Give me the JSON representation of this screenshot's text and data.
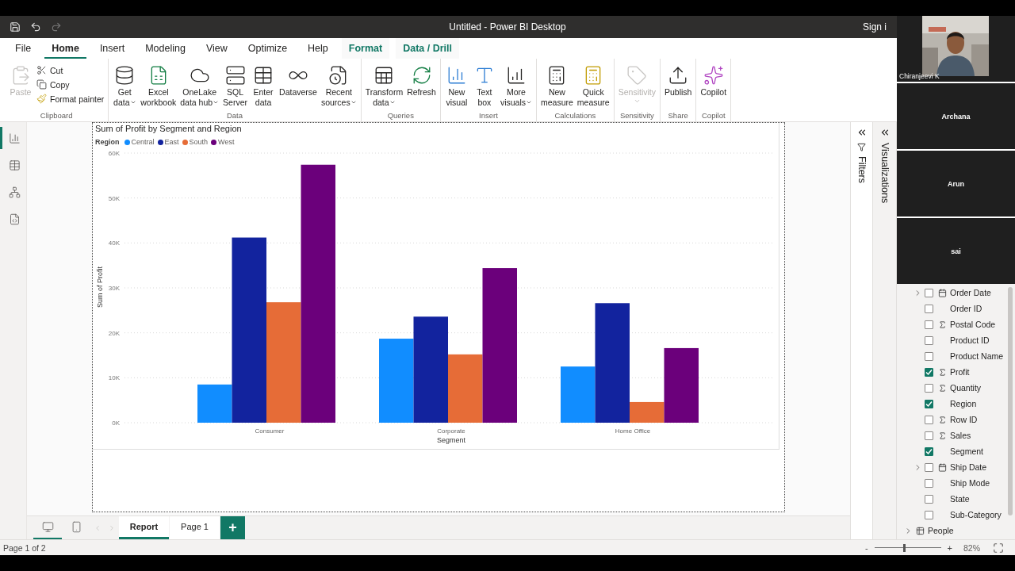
{
  "window": {
    "title": "Untitled - Power BI Desktop",
    "sign_in": "Sign i"
  },
  "menu_tabs": [
    {
      "label": "File",
      "selected": false,
      "kind": "standard"
    },
    {
      "label": "Home",
      "selected": true,
      "kind": "standard"
    },
    {
      "label": "Insert",
      "selected": false,
      "kind": "standard"
    },
    {
      "label": "Modeling",
      "selected": false,
      "kind": "standard"
    },
    {
      "label": "View",
      "selected": false,
      "kind": "standard"
    },
    {
      "label": "Optimize",
      "selected": false,
      "kind": "standard"
    },
    {
      "label": "Help",
      "selected": false,
      "kind": "standard"
    },
    {
      "label": "Format",
      "selected": false,
      "kind": "contextual"
    },
    {
      "label": "Data / Drill",
      "selected": false,
      "kind": "contextual"
    }
  ],
  "ribbon": [
    {
      "label": "Clipboard",
      "large": [
        {
          "lines": [
            "Paste"
          ],
          "disabled": true,
          "dropdown": false
        }
      ],
      "small": [
        {
          "label": "Cut"
        },
        {
          "label": "Copy"
        },
        {
          "label": "Format painter"
        }
      ]
    },
    {
      "label": "Data",
      "large": [
        {
          "lines": [
            "Get",
            "data"
          ],
          "disabled": false,
          "dropdown": true
        },
        {
          "lines": [
            "Excel",
            "workbook"
          ],
          "disabled": false,
          "dropdown": false
        },
        {
          "lines": [
            "OneLake",
            "data hub"
          ],
          "disabled": false,
          "dropdown": true
        },
        {
          "lines": [
            "SQL",
            "Server"
          ],
          "disabled": false,
          "dropdown": false
        },
        {
          "lines": [
            "Enter",
            "data"
          ],
          "disabled": false,
          "dropdown": false
        },
        {
          "lines": [
            "Dataverse"
          ],
          "disabled": false,
          "dropdown": false
        },
        {
          "lines": [
            "Recent",
            "sources"
          ],
          "disabled": false,
          "dropdown": true
        }
      ]
    },
    {
      "label": "Queries",
      "large": [
        {
          "lines": [
            "Transform",
            "data"
          ],
          "disabled": false,
          "dropdown": true
        },
        {
          "lines": [
            "Refresh"
          ],
          "disabled": false,
          "dropdown": false
        }
      ]
    },
    {
      "label": "Insert",
      "large": [
        {
          "lines": [
            "New",
            "visual"
          ],
          "disabled": false,
          "dropdown": false
        },
        {
          "lines": [
            "Text",
            "box"
          ],
          "disabled": false,
          "dropdown": false
        },
        {
          "lines": [
            "More",
            "visuals"
          ],
          "disabled": false,
          "dropdown": true
        }
      ]
    },
    {
      "label": "Calculations",
      "large": [
        {
          "lines": [
            "New",
            "measure"
          ],
          "disabled": false,
          "dropdown": false
        },
        {
          "lines": [
            "Quick",
            "measure"
          ],
          "disabled": false,
          "dropdown": false
        }
      ]
    },
    {
      "label": "Sensitivity",
      "large": [
        {
          "lines": [
            "Sensitivity"
          ],
          "disabled": true,
          "dropdown": true
        }
      ]
    },
    {
      "label": "Share",
      "large": [
        {
          "lines": [
            "Publish"
          ],
          "disabled": false,
          "dropdown": false
        }
      ]
    },
    {
      "label": "Copilot",
      "large": [
        {
          "lines": [
            "Copilot"
          ],
          "disabled": false,
          "dropdown": false
        }
      ]
    }
  ],
  "left_nav": [
    {
      "selected": true
    },
    {
      "selected": false
    },
    {
      "selected": false
    },
    {
      "selected": false
    }
  ],
  "visual": {
    "legend_title": "Region",
    "chart_data": {
      "type": "bar",
      "title": "Sum of Profit by Segment and Region",
      "xlabel": "Segment",
      "ylabel": "Sum of Profit",
      "categories": [
        "Consumer",
        "Corporate",
        "Home Office"
      ],
      "series": [
        {
          "name": "Central",
          "color": "#118dff",
          "values": [
            8500,
            18700,
            12500
          ]
        },
        {
          "name": "East",
          "color": "#12239e",
          "values": [
            41200,
            23600,
            26600
          ]
        },
        {
          "name": "South",
          "color": "#e66c37",
          "values": [
            26800,
            15200,
            4600
          ]
        },
        {
          "name": "West",
          "color": "#6b007b",
          "values": [
            57400,
            34400,
            16600
          ]
        }
      ],
      "ylim": [
        0,
        60000
      ],
      "grid": true,
      "yticks": [
        {
          "value": 0,
          "label": "0K"
        },
        {
          "value": 10000,
          "label": "10K"
        },
        {
          "value": 20000,
          "label": "20K"
        },
        {
          "value": 30000,
          "label": "30K"
        },
        {
          "value": 40000,
          "label": "40K"
        },
        {
          "value": 50000,
          "label": "50K"
        },
        {
          "value": 60000,
          "label": "60K"
        }
      ]
    }
  },
  "panes": {
    "filters": "Filters",
    "visualizations": "Visualizations"
  },
  "fields": [
    {
      "label": "Order Date",
      "checked": false,
      "kind": "date",
      "expanded": false
    },
    {
      "label": "Order ID",
      "checked": false,
      "kind": "text"
    },
    {
      "label": "Postal Code",
      "checked": false,
      "kind": "numeric"
    },
    {
      "label": "Product ID",
      "checked": false,
      "kind": "text"
    },
    {
      "label": "Product Name",
      "checked": false,
      "kind": "text"
    },
    {
      "label": "Profit",
      "checked": true,
      "kind": "numeric"
    },
    {
      "label": "Quantity",
      "checked": false,
      "kind": "numeric"
    },
    {
      "label": "Region",
      "checked": true,
      "kind": "text"
    },
    {
      "label": "Row ID",
      "checked": false,
      "kind": "numeric"
    },
    {
      "label": "Sales",
      "checked": false,
      "kind": "numeric"
    },
    {
      "label": "Segment",
      "checked": true,
      "kind": "text"
    },
    {
      "label": "Ship Date",
      "checked": false,
      "kind": "date",
      "expanded": false
    },
    {
      "label": "Ship Mode",
      "checked": false,
      "kind": "text"
    },
    {
      "label": "State",
      "checked": false,
      "kind": "text"
    },
    {
      "label": "Sub-Category",
      "checked": false,
      "kind": "text"
    }
  ],
  "tables": [
    {
      "label": "People",
      "expanded": false
    }
  ],
  "view_modes": [
    {
      "selected": true
    },
    {
      "selected": false
    }
  ],
  "page_tabs": [
    {
      "label": "Report",
      "selected": true
    },
    {
      "label": "Page 1",
      "selected": false
    }
  ],
  "add_page": "+",
  "status_bar": {
    "page": "Page 1 of 2",
    "zoom_out": "-",
    "zoom_in": "+",
    "zoom": {
      "level": 0.44
    },
    "zoom_reading": "82%"
  },
  "participants": [
    {
      "name": "Chiranjeevi K",
      "video": true
    },
    {
      "name": "Archana",
      "video": false
    },
    {
      "name": "Arun",
      "video": false
    },
    {
      "name": "sai",
      "video": false
    }
  ]
}
